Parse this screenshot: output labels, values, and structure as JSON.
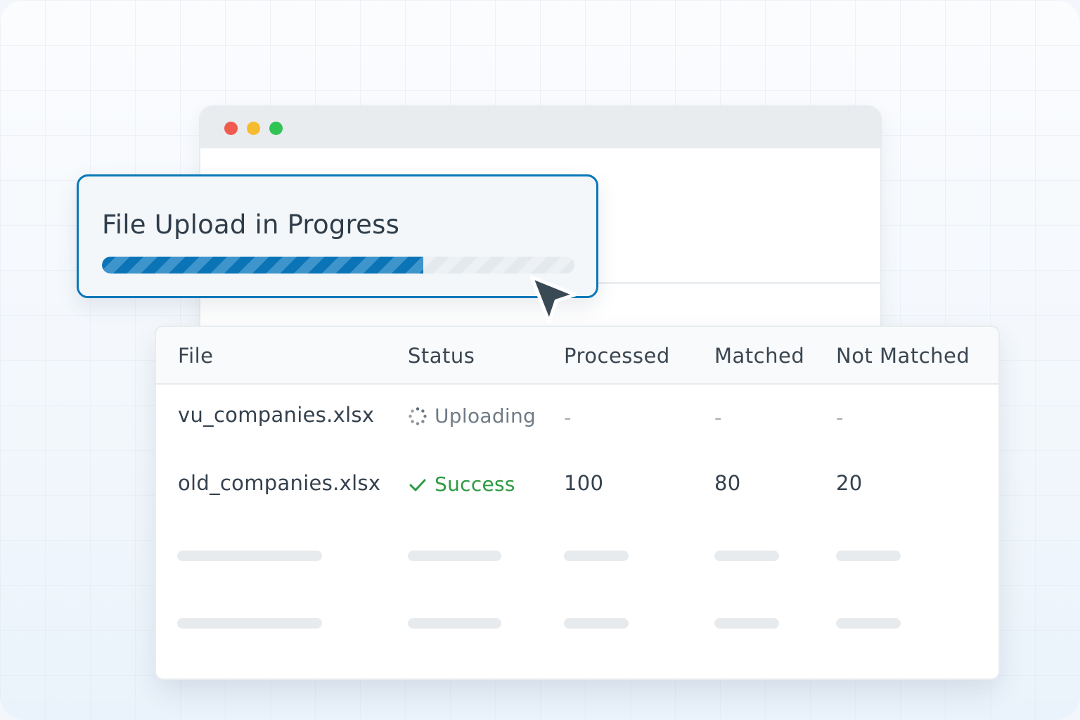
{
  "upload": {
    "title": "File Upload in Progress",
    "progress_fraction": 0.68
  },
  "table": {
    "headers": {
      "file": "File",
      "status": "Status",
      "processed": "Processed",
      "matched": "Matched",
      "not_matched": "Not Matched"
    },
    "rows": [
      {
        "file": "vu_companies.xlsx",
        "status": "Uploading",
        "status_icon": "spinner-icon",
        "processed": "-",
        "matched": "-",
        "not_matched": "-"
      },
      {
        "file": "old_companies.xlsx",
        "status": "Success",
        "status_icon": "check-icon",
        "processed": "100",
        "matched": "80",
        "not_matched": "20"
      }
    ]
  },
  "colors": {
    "accent": "#0a78b8",
    "success": "#2e9a42",
    "muted": "#6f7b86",
    "traffic_red": "#f05a4f",
    "traffic_yellow": "#f7bb2f",
    "traffic_green": "#30c455"
  }
}
